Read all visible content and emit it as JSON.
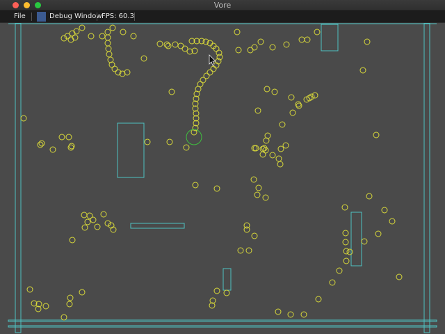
{
  "window": {
    "title": "Vore"
  },
  "menu": {
    "file": "File",
    "debug_window": "Debug Window",
    "fps": "FPS: 60.3"
  },
  "colors": {
    "food": "#d9d93a",
    "wall": "#4fc2c2",
    "player": "#3fbf3f",
    "background": "#4a4a4a"
  },
  "icons": {
    "cursor": "mouse-pointer-icon"
  }
}
